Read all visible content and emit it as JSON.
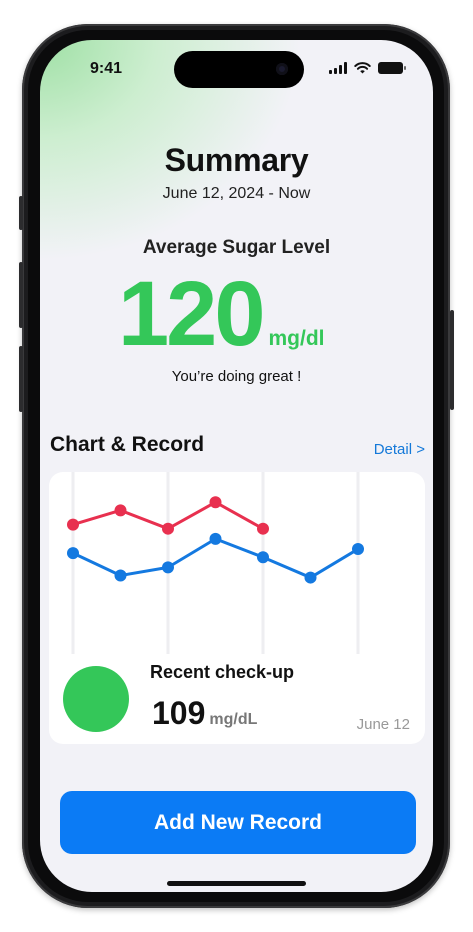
{
  "status_bar": {
    "time": "9:41"
  },
  "header": {
    "title": "Summary",
    "date_range": "June 12, 2024 - Now"
  },
  "average": {
    "label": "Average Sugar Level",
    "value": "120",
    "unit": "mg/dl",
    "message": "You’re doing great !"
  },
  "section": {
    "title": "Chart & Record",
    "detail_link": "Detail >"
  },
  "chart_data": {
    "type": "line",
    "series": [
      {
        "color": "#e8304f",
        "values": [
          138,
          145,
          136,
          149,
          136
        ]
      },
      {
        "color": "#1479e0",
        "values": [
          124,
          113,
          117,
          131,
          122,
          112,
          126
        ]
      }
    ],
    "ylim": [
      100,
      155
    ],
    "grid": true
  },
  "recent": {
    "label": "Recent check-up",
    "value": "109",
    "unit": "mg/dL",
    "date": "June 12",
    "status_color": "#34c759"
  },
  "actions": {
    "add_record": "Add New Record"
  },
  "colors": {
    "accent": "#34c759",
    "primary": "#0b7bf5",
    "link": "#1479d9"
  }
}
